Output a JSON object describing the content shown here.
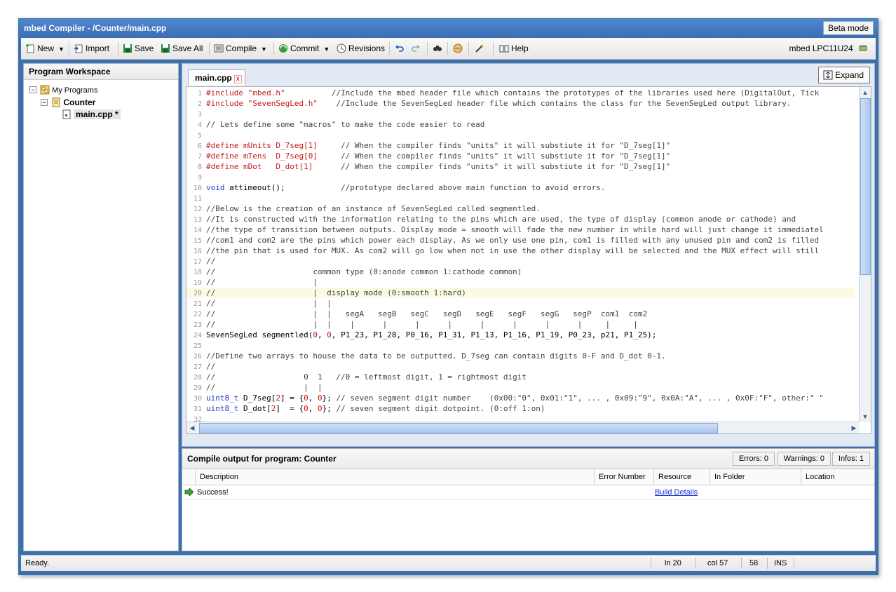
{
  "window": {
    "title": "mbed Compiler - /Counter/main.cpp",
    "beta_label": "Beta mode"
  },
  "toolbar": {
    "new": "New",
    "import": "Import",
    "save": "Save",
    "save_all": "Save All",
    "compile": "Compile",
    "commit": "Commit",
    "revisions": "Revisions",
    "help": "Help",
    "target": "mbed LPC11U24",
    "icons": [
      "new-file-icon",
      "import-icon",
      "save-icon",
      "save-all-icon",
      "compile-icon",
      "commit-icon",
      "revisions-icon",
      "undo-icon",
      "redo-icon",
      "find-icon",
      "import-library-icon",
      "format-icon",
      "help-book-icon",
      "target-device-icon"
    ]
  },
  "workspace": {
    "title": "Program Workspace",
    "root": "My Programs",
    "program": "Counter",
    "file": "main.cpp *"
  },
  "editor": {
    "tab_label": "main.cpp",
    "tab_close": "x",
    "expand_label": "Expand",
    "current_line": 20,
    "lines": [
      [
        [
          "pp",
          "#include "
        ],
        [
          "str",
          "\"mbed.h\""
        ],
        [
          "cm",
          "          //Include the mbed header file which contains the prototypes of the libraries used here (DigitalOut, Tick"
        ]
      ],
      [
        [
          "pp",
          "#include "
        ],
        [
          "str",
          "\"SevenSegLed.h\""
        ],
        [
          "cm",
          "    //Include the SevenSegLed header file which contains the class for the SevenSegLed output library."
        ]
      ],
      [],
      [
        [
          "cm",
          "// Lets define some \"macros\" to make the code easier to read"
        ]
      ],
      [],
      [
        [
          "pp",
          "#define mUnits D_7seg[1]"
        ],
        [
          "cm",
          "     // When the compiler finds \"units\" it will substiute it for \"D_7seg[1]\""
        ]
      ],
      [
        [
          "pp",
          "#define mTens  D_7seg[0]"
        ],
        [
          "cm",
          "     // When the compiler finds \"units\" it will substiute it for \"D_7seg[1]\""
        ]
      ],
      [
        [
          "pp",
          "#define mDot   D_dot[1]"
        ],
        [
          "cm",
          "      // When the compiler finds \"units\" it will substiute it for \"D_7seg[1]\""
        ]
      ],
      [],
      [
        [
          "kw",
          "void"
        ],
        [
          "t",
          " attimeout();"
        ],
        [
          "cm",
          "            //prototype declared above main function to avoid errors."
        ]
      ],
      [],
      [
        [
          "cm",
          "//Below is the creation of an instance of SevenSegLed called segmentled."
        ]
      ],
      [
        [
          "cm",
          "//It is constructed with the information relating to the pins which are used, the type of display (common anode or cathode) and"
        ]
      ],
      [
        [
          "cm",
          "//the type of transition between outputs. Display mode = smooth will fade the new number in while hard will just change it immediatel"
        ]
      ],
      [
        [
          "cm",
          "//com1 and com2 are the pins which power each display. As we only use one pin, com1 is filled with any unused pin and com2 is filled"
        ]
      ],
      [
        [
          "cm",
          "//the pin that is used for MUX. As com2 will go low when not in use the other display will be selected and the MUX effect will still "
        ]
      ],
      [
        [
          "cm",
          "//"
        ]
      ],
      [
        [
          "cm",
          "//                     common type (0:anode common 1:cathode common)"
        ]
      ],
      [
        [
          "cm",
          "//                     |"
        ]
      ],
      [
        [
          "cm",
          "//                     |  display mode (0:smooth 1:hard)"
        ]
      ],
      [
        [
          "cm",
          "//                     |  |"
        ]
      ],
      [
        [
          "cm",
          "//                     |  |   segA   segB   segC   segD   segE   segF   segG   segP  com1  com2"
        ]
      ],
      [
        [
          "cm",
          "//                     |  |    |      |      |      |      |      |      |      |     |     |"
        ]
      ],
      [
        [
          "t",
          "SevenSegLed segmentled("
        ],
        [
          "num",
          "0"
        ],
        [
          "t",
          ", "
        ],
        [
          "num",
          "0"
        ],
        [
          "t",
          ", P1_23, P1_28, P0_16, P1_31, P1_13, P1_16, P1_19, P0_23, p21, P1_25);"
        ]
      ],
      [],
      [
        [
          "cm",
          "//Define two arrays to house the data to be outputted. D_7seg can contain digits 0-F and D_dot 0-1."
        ]
      ],
      [
        [
          "cm",
          "//"
        ]
      ],
      [
        [
          "cm",
          "//                   0  1   //0 = leftmost digit, 1 = rightmost digit"
        ]
      ],
      [
        [
          "cm",
          "//                   |  |"
        ]
      ],
      [
        [
          "kw",
          "uint8_t"
        ],
        [
          "t",
          " D_7seg["
        ],
        [
          "num",
          "2"
        ],
        [
          "t",
          "] = {"
        ],
        [
          "num",
          "0"
        ],
        [
          "t",
          ", "
        ],
        [
          "num",
          "0"
        ],
        [
          "t",
          "}; "
        ],
        [
          "cm",
          "// seven segment digit number    (0x00:\"0\", 0x01:\"1\", ... , 0x09:\"9\", 0x0A:\"A\", ... , 0x0F:\"F\", other:\" \""
        ]
      ],
      [
        [
          "kw",
          "uint8_t"
        ],
        [
          "t",
          " D_dot["
        ],
        [
          "num",
          "2"
        ],
        [
          "t",
          "]  = {"
        ],
        [
          "num",
          "0"
        ],
        [
          "t",
          ", "
        ],
        [
          "num",
          "0"
        ],
        [
          "t",
          "}; "
        ],
        [
          "cm",
          "// seven segment digit dotpoint. (0:off 1:on)"
        ]
      ],
      []
    ]
  },
  "output": {
    "title": "Compile output for program: Counter",
    "errors": "Errors: 0",
    "warnings": "Warnings: 0",
    "infos": "Infos: 1",
    "columns": [
      "Description",
      "Error Number",
      "Resource",
      "In Folder",
      "Location"
    ],
    "rows": [
      {
        "description": "Success!",
        "error_number": "",
        "resource": "Build Details",
        "folder": "",
        "location": ""
      }
    ]
  },
  "status": {
    "text": "Ready.",
    "line": "ln 20",
    "col": "col 57",
    "chars": "58",
    "mode": "INS"
  }
}
